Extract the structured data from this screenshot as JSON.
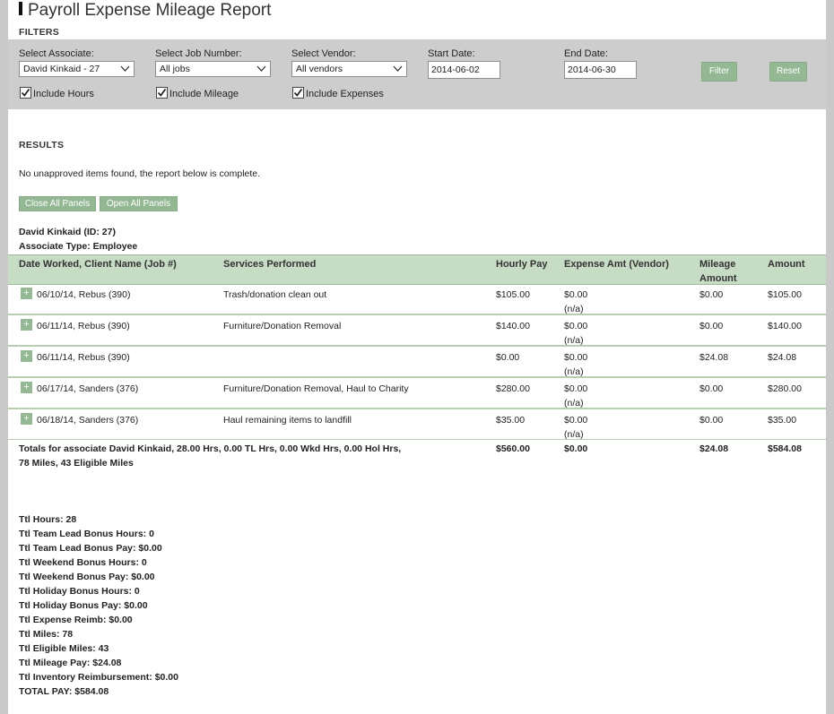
{
  "title": "Payroll Expense Mileage Report",
  "filters": {
    "heading": "FILTERS",
    "associate": {
      "label": "Select Associate:",
      "value": "David Kinkaid - 27"
    },
    "job": {
      "label": "Select Job Number:",
      "value": "All jobs"
    },
    "vendor": {
      "label": "Select Vendor:",
      "value": "All vendors"
    },
    "start_date": {
      "label": "Start Date:",
      "value": "2014-06-02"
    },
    "end_date": {
      "label": "End Date:",
      "value": "2014-06-30"
    },
    "filter_button": "Filter",
    "reset_button": "Reset",
    "include_hours": {
      "label": "Include Hours",
      "checked": true
    },
    "include_mileage": {
      "label": "Include Mileage",
      "checked": true
    },
    "include_expenses": {
      "label": "Include Expenses",
      "checked": true
    }
  },
  "results": {
    "heading": "RESULTS",
    "message": "No unapproved items found, the report below is complete.",
    "close_all": "Close All Panels",
    "open_all": "Open All Panels",
    "associate_line": "David Kinkaid (ID: 27)",
    "type_line": "Associate Type: Employee",
    "columns": {
      "date": "Date Worked, Client Name (Job #)",
      "services": "Services Performed",
      "hourly": "Hourly Pay",
      "expense": "Expense Amt (Vendor)",
      "mileage": "Mileage Amount",
      "amount": "Amount"
    },
    "rows": [
      {
        "date": "06/10/14, Rebus (390)",
        "services": "Trash/donation clean out",
        "hourly": "$105.00",
        "expense": "$0.00",
        "vendor": "(n/a)",
        "mileage": "$0.00",
        "amount": "$105.00"
      },
      {
        "date": "06/11/14, Rebus (390)",
        "services": "Furniture/Donation Removal",
        "hourly": "$140.00",
        "expense": "$0.00",
        "vendor": "(n/a)",
        "mileage": "$0.00",
        "amount": "$140.00"
      },
      {
        "date": "06/11/14, Rebus (390)",
        "services": "",
        "hourly": "$0.00",
        "expense": "$0.00",
        "vendor": "(n/a)",
        "mileage": "$24.08",
        "amount": "$24.08"
      },
      {
        "date": "06/17/14, Sanders (376)",
        "services": "Furniture/Donation Removal, Haul to Charity",
        "hourly": "$280.00",
        "expense": "$0.00",
        "vendor": "(n/a)",
        "mileage": "$0.00",
        "amount": "$280.00"
      },
      {
        "date": "06/18/14, Sanders (376)",
        "services": "Haul remaining items to landfill",
        "hourly": "$35.00",
        "expense": "$0.00",
        "vendor": "(n/a)",
        "mileage": "$0.00",
        "amount": "$35.00"
      }
    ],
    "expand_symbol": "+",
    "totals": {
      "label_line1": "Totals for associate David Kinkaid, 28.00 Hrs, 0.00 TL Hrs, 0.00 Wkd Hrs, 0.00 Hol Hrs,",
      "label_line2": "78 Miles, 43 Eligible Miles",
      "hourly": "$560.00",
      "expense": "$0.00",
      "mileage": "$24.08",
      "amount": "$584.08"
    }
  },
  "summary": [
    "Ttl Hours: 28",
    "Ttl Team Lead Bonus Hours: 0",
    "Ttl Team Lead Bonus Pay: $0.00",
    "Ttl Weekend Bonus Hours: 0",
    "Ttl Weekend Bonus Pay: $0.00",
    "Ttl Holiday Bonus Hours: 0",
    "Ttl Holiday Bonus Pay: $0.00",
    "Ttl Expense Reimb: $0.00",
    "Ttl Miles: 78",
    "Ttl Eligible Miles: 43",
    "Ttl Mileage Pay: $24.08",
    "Ttl Inventory Reimbursement: $0.00",
    "TOTAL PAY: $584.08"
  ],
  "colors": {
    "accent_green": "#93b893",
    "header_green": "#c7dcc4",
    "filter_bg": "#cdcdcd"
  }
}
